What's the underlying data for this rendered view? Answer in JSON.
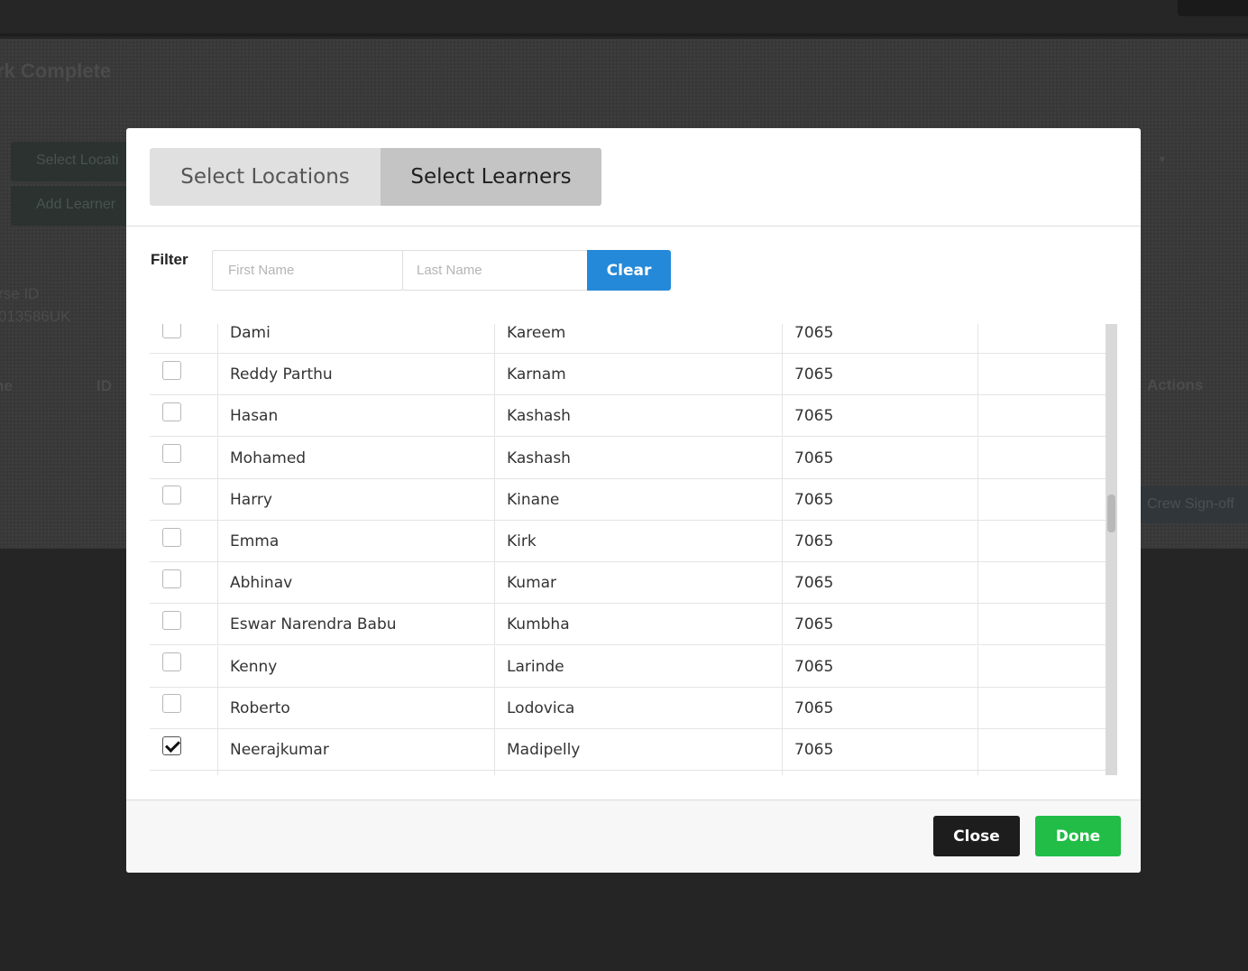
{
  "background": {
    "page_title": "rk Complete",
    "select_locations_btn": "Select Locati",
    "add_learners_btn": "Add Learner",
    "course_id_label": "rse ID",
    "course_id_value": "013586UK",
    "col_name": "ne",
    "col_id": "ID",
    "col_actions": "Actions",
    "crew_signoff": "Crew Sign-off"
  },
  "modal": {
    "tabs": [
      {
        "label": "Select Locations",
        "active": false
      },
      {
        "label": "Select Learners",
        "active": true
      }
    ],
    "filter": {
      "label": "Filter",
      "first_name_placeholder": "First Name",
      "last_name_placeholder": "Last Name",
      "clear_label": "Clear"
    },
    "learners": [
      {
        "first": "Dami",
        "last": "Kareem",
        "id": "7065",
        "checked": false
      },
      {
        "first": "Reddy Parthu",
        "last": "Karnam",
        "id": "7065",
        "checked": false
      },
      {
        "first": "Hasan",
        "last": "Kashash",
        "id": "7065",
        "checked": false
      },
      {
        "first": "Mohamed",
        "last": "Kashash",
        "id": "7065",
        "checked": false
      },
      {
        "first": "Harry",
        "last": "Kinane",
        "id": "7065",
        "checked": false
      },
      {
        "first": "Emma",
        "last": "Kirk",
        "id": "7065",
        "checked": false
      },
      {
        "first": "Abhinav",
        "last": "Kumar",
        "id": "7065",
        "checked": false
      },
      {
        "first": "Eswar Narendra Babu",
        "last": "Kumbha",
        "id": "7065",
        "checked": false
      },
      {
        "first": "Kenny",
        "last": "Larinde",
        "id": "7065",
        "checked": false
      },
      {
        "first": "Roberto",
        "last": "Lodovica",
        "id": "7065",
        "checked": false
      },
      {
        "first": "Neerajkumar",
        "last": "Madipelly",
        "id": "7065",
        "checked": true
      }
    ],
    "footer": {
      "close_label": "Close",
      "done_label": "Done"
    }
  },
  "colors": {
    "clear_button": "#2489d8",
    "done_button": "#21bd46",
    "close_button": "#1d1d1d",
    "active_tab": "#c4c4c4"
  }
}
